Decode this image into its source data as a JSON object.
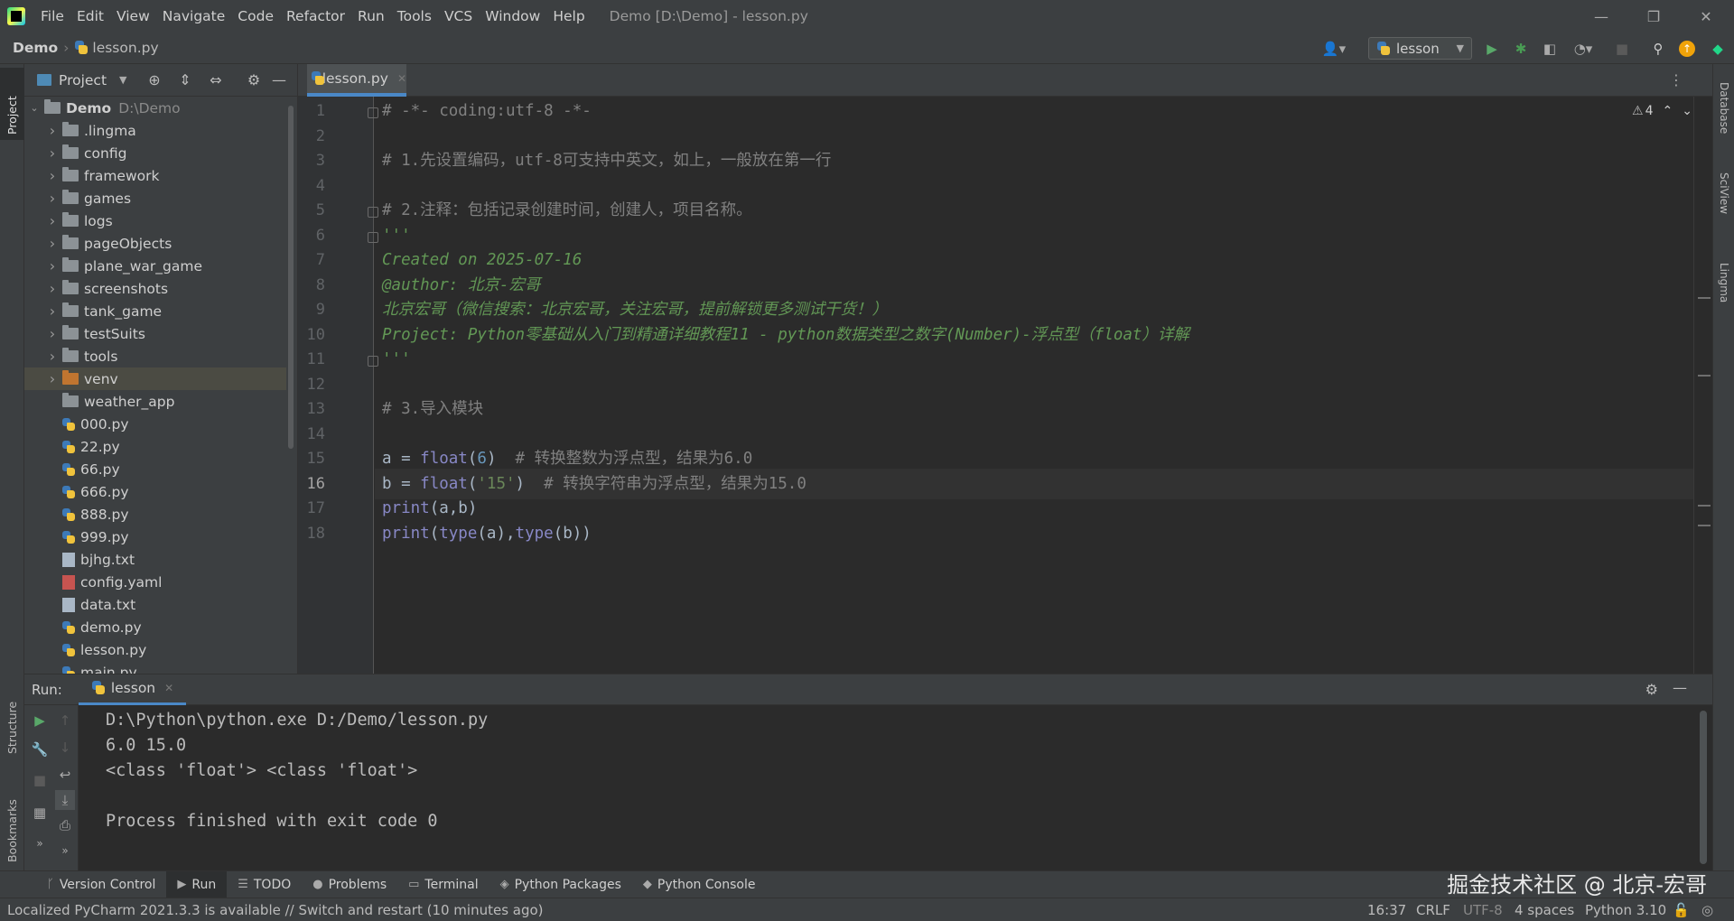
{
  "menu": [
    "File",
    "Edit",
    "View",
    "Navigate",
    "Code",
    "Refactor",
    "Run",
    "Tools",
    "VCS",
    "Window",
    "Help"
  ],
  "window_title": "Demo [D:\\Demo] - lesson.py",
  "window_controls": {
    "minimize": "—",
    "restore": "❐",
    "close": "✕"
  },
  "breadcrumb": {
    "root": "Demo",
    "file": "lesson.py"
  },
  "run_config": "lesson",
  "project_panel": {
    "title": "Project",
    "root": {
      "name": "Demo",
      "path": "D:\\Demo"
    },
    "items": [
      {
        "name": ".lingma",
        "kind": "folder"
      },
      {
        "name": "config",
        "kind": "folder"
      },
      {
        "name": "framework",
        "kind": "folder"
      },
      {
        "name": "games",
        "kind": "folder"
      },
      {
        "name": "logs",
        "kind": "folder"
      },
      {
        "name": "pageObjects",
        "kind": "folder"
      },
      {
        "name": "plane_war_game",
        "kind": "folder"
      },
      {
        "name": "screenshots",
        "kind": "folder"
      },
      {
        "name": "tank_game",
        "kind": "folder"
      },
      {
        "name": "testSuits",
        "kind": "folder"
      },
      {
        "name": "tools",
        "kind": "folder"
      },
      {
        "name": "venv",
        "kind": "folder-excluded"
      },
      {
        "name": "weather_app",
        "kind": "folder-plain"
      },
      {
        "name": "000.py",
        "kind": "py"
      },
      {
        "name": "22.py",
        "kind": "py"
      },
      {
        "name": "66.py",
        "kind": "py"
      },
      {
        "name": "666.py",
        "kind": "py"
      },
      {
        "name": "888.py",
        "kind": "py"
      },
      {
        "name": "999.py",
        "kind": "py"
      },
      {
        "name": "bjhg.txt",
        "kind": "txt"
      },
      {
        "name": "config.yaml",
        "kind": "yml"
      },
      {
        "name": "data.txt",
        "kind": "txt"
      },
      {
        "name": "demo.py",
        "kind": "py"
      },
      {
        "name": "lesson.py",
        "kind": "py"
      },
      {
        "name": "main.py",
        "kind": "py"
      }
    ]
  },
  "editor": {
    "tab": "lesson.py",
    "current_line": 16,
    "warnings": "4",
    "lines": [
      {
        "n": "1",
        "t": "# -*- coding:utf-8 -*-"
      },
      {
        "n": "2",
        "t": ""
      },
      {
        "n": "3",
        "t": "# 1.先设置编码，utf-8可支持中英文，如上，一般放在第一行"
      },
      {
        "n": "4",
        "t": ""
      },
      {
        "n": "5",
        "t": "# 2.注释：包括记录创建时间，创建人，项目名称。"
      },
      {
        "n": "6",
        "t": "'''"
      },
      {
        "n": "7",
        "t": "Created on 2025-07-16"
      },
      {
        "n": "8",
        "t": "@author: 北京-宏哥"
      },
      {
        "n": "9",
        "t": "北京宏哥（微信搜索：北京宏哥，关注宏哥，提前解锁更多测试干货！）"
      },
      {
        "n": "10",
        "t": "Project: Python零基础从入门到精通详细教程11 - python数据类型之数字(Number)-浮点型（float）详解"
      },
      {
        "n": "11",
        "t": "'''"
      },
      {
        "n": "12",
        "t": ""
      },
      {
        "n": "13",
        "t": "# 3.导入模块"
      },
      {
        "n": "14",
        "t": ""
      },
      {
        "n": "15",
        "t": "a = float(6)  # 转换整数为浮点型，结果为6.0"
      },
      {
        "n": "16",
        "t": "b = float('15')  # 转换字符串为浮点型，结果为15.0"
      },
      {
        "n": "17",
        "t": "print(a,b)"
      },
      {
        "n": "18",
        "t": "print(type(a),type(b))"
      }
    ]
  },
  "run": {
    "label": "Run:",
    "tab": "lesson",
    "output": [
      "D:\\Python\\python.exe D:/Demo/lesson.py",
      "6.0 15.0",
      "<class 'float'> <class 'float'>",
      "",
      "Process finished with exit code 0"
    ]
  },
  "left_stripe": [
    "Project",
    "Structure",
    "Bookmarks"
  ],
  "right_stripe": [
    "Database",
    "SciView",
    "Lingma"
  ],
  "bottom_tools": [
    "Version Control",
    "Run",
    "TODO",
    "Problems",
    "Terminal",
    "Python Packages",
    "Python Console"
  ],
  "watermark": "掘金技术社区 @ 北京-宏哥",
  "status": {
    "message": "Localized PyCharm 2021.3.3 is available // Switch and restart (10 minutes ago)",
    "position": "16:37",
    "line_sep": "CRLF",
    "encoding": "UTF-8",
    "indent": "4 spaces",
    "interpreter": "Python 3.10"
  },
  "colors": {
    "accent": "#4a88c7",
    "run_green": "#59a869",
    "debug_green": "#499c54",
    "update_orange": "#f0a30a"
  }
}
